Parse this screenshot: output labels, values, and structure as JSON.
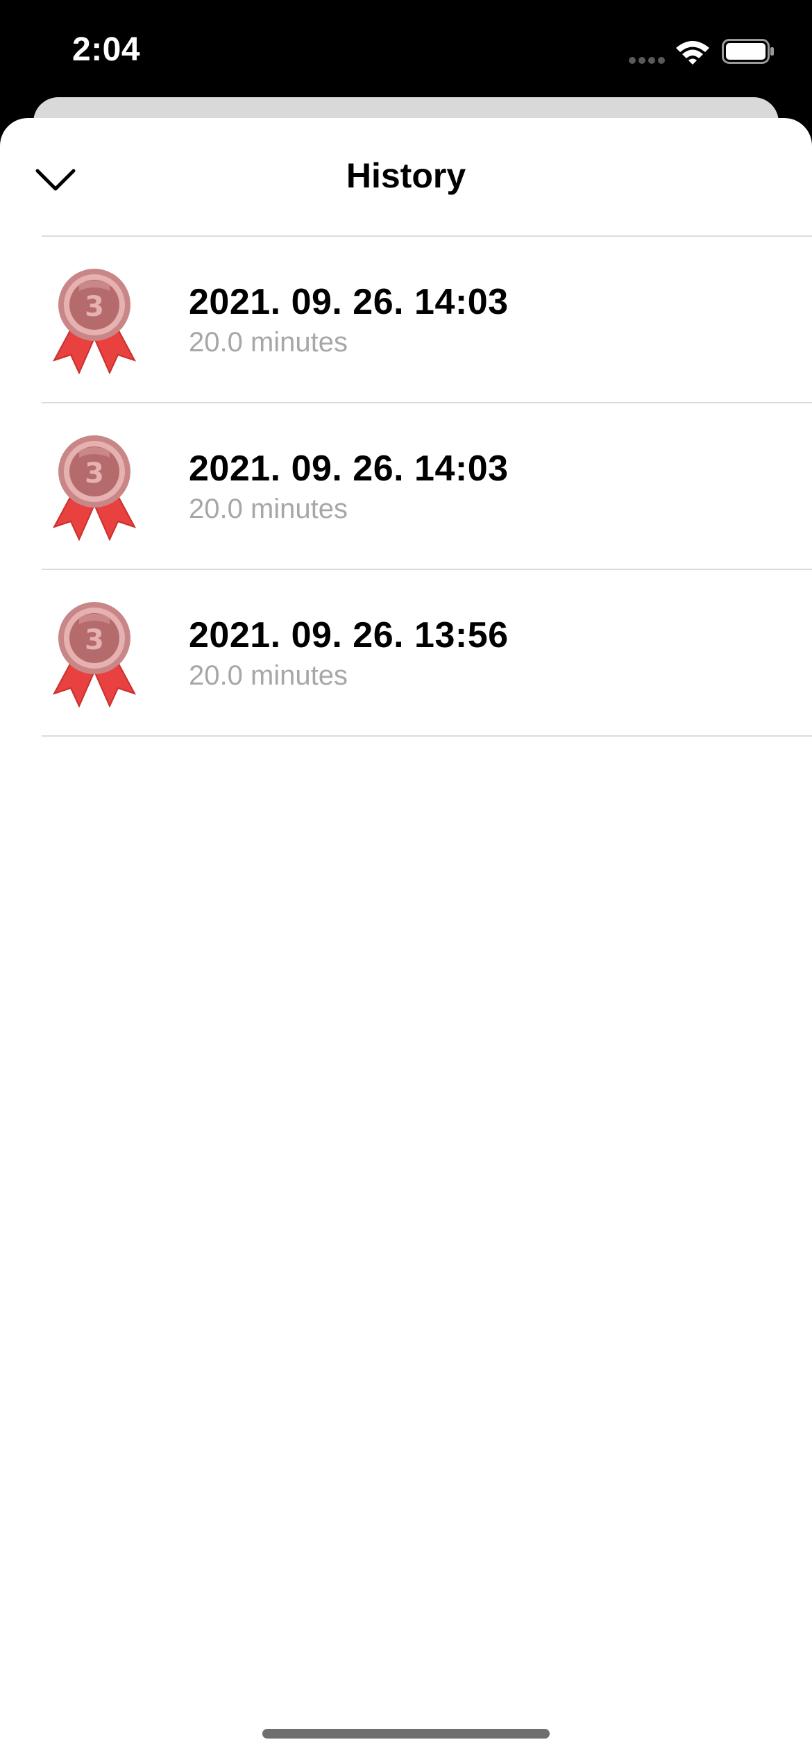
{
  "status_bar": {
    "time": "2:04",
    "icons": [
      "cellular-signal-icon",
      "wifi-icon",
      "battery-icon"
    ]
  },
  "header": {
    "dismiss_icon": "chevron-down-icon",
    "title": "History"
  },
  "history": [
    {
      "date": "2021. 09. 26. 14:03",
      "duration": "20.0 minutes",
      "medal_icon": "bronze-medal-icon",
      "medal_rank": "3"
    },
    {
      "date": "2021. 09. 26. 14:03",
      "duration": "20.0 minutes",
      "medal_icon": "bronze-medal-icon",
      "medal_rank": "3"
    },
    {
      "date": "2021. 09. 26. 13:56",
      "duration": "20.0 minutes",
      "medal_icon": "bronze-medal-icon",
      "medal_rank": "3"
    }
  ],
  "colors": {
    "medal_face": "#c98686",
    "medal_ribbon": "#e8413f",
    "separator": "#dcdcdc",
    "secondary_text": "#a7a7a7"
  }
}
